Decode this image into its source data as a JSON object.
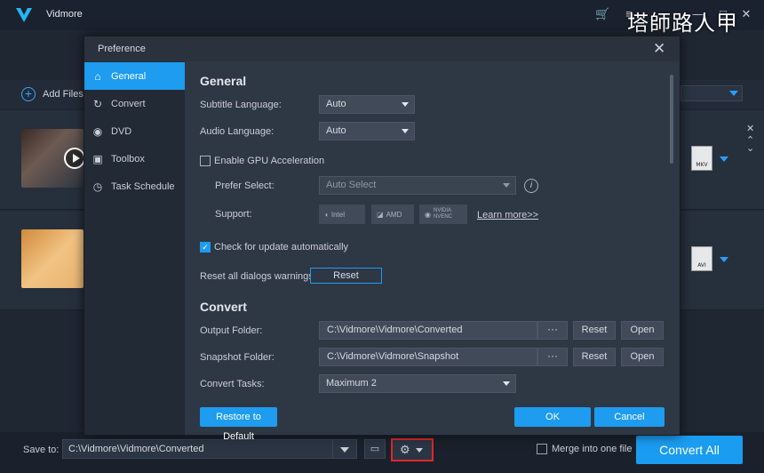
{
  "app": {
    "name": "Vidmore",
    "watermark": "塔師路人甲",
    "add_files": "Add Files"
  },
  "bottom": {
    "save_label": "Save to:",
    "save_path": "C:\\Vidmore\\Vidmore\\Converted",
    "merge_label": "Merge into one file",
    "merge_checked": false,
    "convert_all": "Convert All"
  },
  "files": [
    {
      "format": "MKV"
    },
    {
      "format": "AVI"
    }
  ],
  "dialog": {
    "title": "Preference",
    "nav": [
      {
        "label": "General",
        "icon": "home-icon",
        "active": true
      },
      {
        "label": "Convert",
        "icon": "refresh-icon",
        "active": false
      },
      {
        "label": "DVD",
        "icon": "disc-icon",
        "active": false
      },
      {
        "label": "Toolbox",
        "icon": "toolbox-icon",
        "active": false
      },
      {
        "label": "Task Schedule",
        "icon": "clock-icon",
        "active": false
      }
    ],
    "general": {
      "heading": "General",
      "subtitle_label": "Subtitle Language:",
      "subtitle_value": "Auto",
      "audio_label": "Audio Language:",
      "audio_value": "Auto",
      "gpu_label": "Enable GPU Acceleration",
      "gpu_checked": false,
      "prefer_label": "Prefer Select:",
      "prefer_value": "Auto Select",
      "support_label": "Support:",
      "chips": [
        "Intel",
        "AMD",
        "NVIDIA NVENC"
      ],
      "learn_more": "Learn more>>",
      "update_label": "Check for update automatically",
      "update_checked": true,
      "reset_warn_label": "Reset all dialogs warnings:",
      "reset_btn": "Reset"
    },
    "convert": {
      "heading": "Convert",
      "output_label": "Output Folder:",
      "output_path": "C:\\Vidmore\\Vidmore\\Converted",
      "snapshot_label": "Snapshot Folder:",
      "snapshot_path": "C:\\Vidmore\\Vidmore\\Snapshot",
      "dots": "···",
      "reset": "Reset",
      "open": "Open",
      "tasks_label": "Convert Tasks:",
      "tasks_value": "Maximum 2"
    },
    "restore": "Restore to Default",
    "ok": "OK",
    "cancel": "Cancel"
  }
}
